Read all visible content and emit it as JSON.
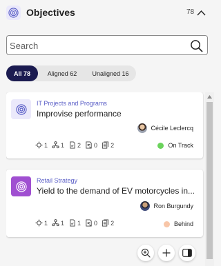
{
  "header": {
    "title": "Objectives",
    "count": "78",
    "icon": "target-icon",
    "collapse_icon": "chevron-up-icon"
  },
  "search": {
    "placeholder": "Search",
    "value": ""
  },
  "filters": [
    {
      "label": "All 78",
      "active": true
    },
    {
      "label": "Aligned 62",
      "active": false
    },
    {
      "label": "Unaligned 16",
      "active": false
    }
  ],
  "cards": [
    {
      "program": "IT Projects and Programs",
      "title": "Improvise performance",
      "owner": "Cécile Leclercq",
      "metrics": [
        "1",
        "1",
        "2",
        "0",
        "2"
      ],
      "status": "On Track",
      "status_color": "#6bd35c",
      "icon_bg": "#ebe9fb"
    },
    {
      "program": "Retail Strategy",
      "title": "Yield to the demand of EV motorcycles in...",
      "owner": "Ron Burgundy",
      "metrics": [
        "1",
        "1",
        "1",
        "0",
        "2"
      ],
      "status": "Behind",
      "status_color": "#f8c6a8",
      "icon_bg": "#a04fd1"
    }
  ],
  "actions": {
    "zoom": "zoom-in-icon",
    "add": "plus-icon",
    "panel": "side-panel-icon"
  },
  "colors": {
    "accent": "#5b5fc7",
    "active_pill": "#1b1b50"
  }
}
